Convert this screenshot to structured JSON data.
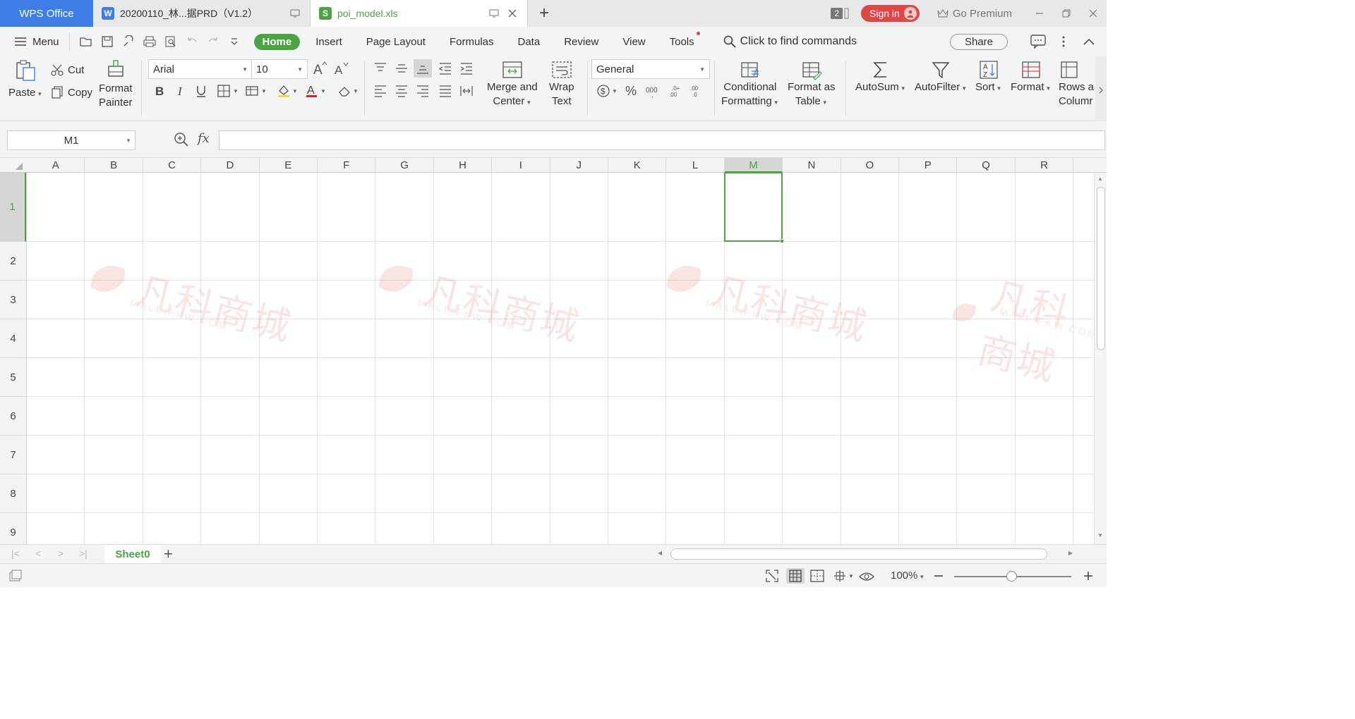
{
  "titlebar": {
    "app_tab": "WPS Office",
    "tabs": [
      {
        "label": "20200110_林...据PRD（V1.2）",
        "badge": "W",
        "badge_color": "#3d7ee7"
      },
      {
        "label": "poi_model.xls",
        "badge": "S",
        "badge_color": "#4aa443"
      }
    ],
    "new_tab": "+",
    "window_count": "2",
    "sign_in": "Sign in",
    "premium": "Go Premium"
  },
  "menubar": {
    "menu": "Menu",
    "tabs": [
      "Home",
      "Insert",
      "Page Layout",
      "Formulas",
      "Data",
      "Review",
      "View",
      "Tools"
    ],
    "find_commands": "Click to find commands",
    "share": "Share"
  },
  "ribbon": {
    "paste": "Paste",
    "cut": "Cut",
    "copy": "Copy",
    "format_painter_1": "Format",
    "format_painter_2": "Painter",
    "font_name": "Arial",
    "font_size": "10",
    "merge_center_1": "Merge and",
    "merge_center_2": "Center",
    "wrap_text_1": "Wrap",
    "wrap_text_2": "Text",
    "number_format": "General",
    "cond_format_1": "Conditional",
    "cond_format_2": "Formatting",
    "format_table_1": "Format as",
    "format_table_2": "Table",
    "autosum": "AutoSum",
    "autofilter": "AutoFilter",
    "sort": "Sort",
    "format": "Format",
    "rows_cols_1": "Rows a",
    "rows_cols_2": "Columr"
  },
  "formula_bar": {
    "name_box": "M1",
    "fx": "fx",
    "formula": ""
  },
  "grid": {
    "columns": [
      "A",
      "B",
      "C",
      "D",
      "E",
      "F",
      "G",
      "H",
      "I",
      "J",
      "K",
      "L",
      "M",
      "N",
      "O",
      "P",
      "Q",
      "R"
    ],
    "rows": [
      "1",
      "2",
      "3",
      "4",
      "5",
      "6",
      "7",
      "8",
      "9"
    ],
    "selected_column": "M",
    "selected_row": "1"
  },
  "watermark": {
    "main": "凡科商城",
    "sub": "MALL.FKW.COM"
  },
  "sheets": {
    "tabs": [
      "Sheet0"
    ],
    "add": "+"
  },
  "statusbar": {
    "zoom": "100%"
  },
  "colors": {
    "accent": "#4aa443",
    "wps_blue": "#3d7ee7",
    "sign_in_red": "#e04646"
  }
}
